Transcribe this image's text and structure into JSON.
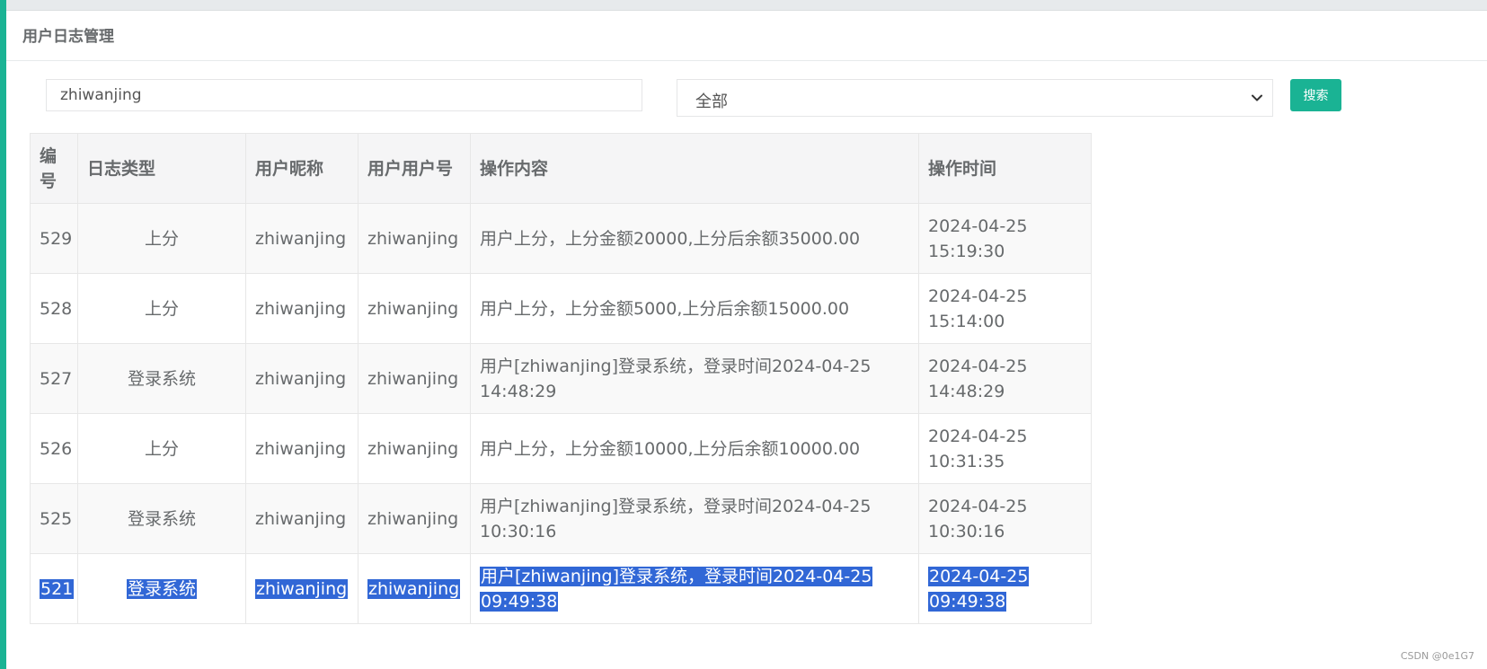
{
  "panel": {
    "title": "用户日志管理"
  },
  "search": {
    "value": "zhiwanjing",
    "type_selected": "全部",
    "button_label": "搜索"
  },
  "table": {
    "headers": {
      "id": "编号",
      "type": "日志类型",
      "nickname": "用户昵称",
      "account": "用户用户号",
      "content": "操作内容",
      "time": "操作时间"
    },
    "rows": [
      {
        "id": "529",
        "type": "上分",
        "nickname": "zhiwanjing",
        "account": "zhiwanjing",
        "content": "用户上分，上分金额20000,上分后余额35000.00",
        "date": "2024-04-25",
        "clock": "15:19:30"
      },
      {
        "id": "528",
        "type": "上分",
        "nickname": "zhiwanjing",
        "account": "zhiwanjing",
        "content": "用户上分，上分金额5000,上分后余额15000.00",
        "date": "2024-04-25",
        "clock": "15:14:00"
      },
      {
        "id": "527",
        "type": "登录系统",
        "nickname": "zhiwanjing",
        "account": "zhiwanjing",
        "content": "用户[zhiwanjing]登录系统，登录时间2024-04-25 14:48:29",
        "date": "2024-04-25",
        "clock": "14:48:29"
      },
      {
        "id": "526",
        "type": "上分",
        "nickname": "zhiwanjing",
        "account": "zhiwanjing",
        "content": "用户上分，上分金额10000,上分后余额10000.00",
        "date": "2024-04-25",
        "clock": "10:31:35"
      },
      {
        "id": "525",
        "type": "登录系统",
        "nickname": "zhiwanjing",
        "account": "zhiwanjing",
        "content": "用户[zhiwanjing]登录系统，登录时间2024-04-25 10:30:16",
        "date": "2024-04-25",
        "clock": "10:30:16"
      },
      {
        "id": "521",
        "type": "登录系统",
        "nickname": "zhiwanjing",
        "account": "zhiwanjing",
        "content": "用户[zhiwanjing]登录系统，登录时间2024-04-25 09:49:38",
        "date": "2024-04-25",
        "clock": "09:49:38"
      }
    ]
  },
  "watermark": "CSDN @0e1G7",
  "colors": {
    "accent": "#1ab394",
    "selection": "#3167d6"
  }
}
